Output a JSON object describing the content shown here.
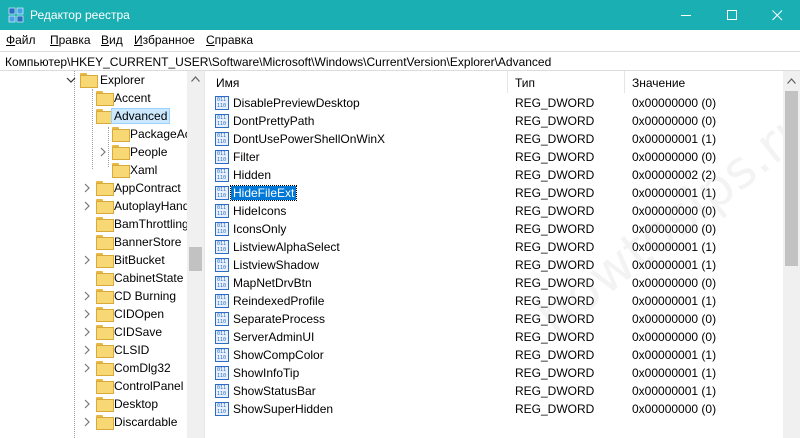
{
  "window": {
    "title": "Редактор реестра",
    "accent": "#1ab0b3"
  },
  "menu": [
    "Файл",
    "Правка",
    "Вид",
    "Избранное",
    "Справка"
  ],
  "address": "Компьютер\\HKEY_CURRENT_USER\\Software\\Microsoft\\Windows\\CurrentVersion\\Explorer\\Advanced",
  "tree": [
    {
      "label": "Explorer",
      "expanded": true
    },
    {
      "label": "Accent"
    },
    {
      "label": "Advanced",
      "selected": true
    },
    {
      "label": "PackageAc"
    },
    {
      "label": "People",
      "expandable": true
    },
    {
      "label": "Xaml"
    },
    {
      "label": "AppContract",
      "expandable": true
    },
    {
      "label": "AutoplayHand",
      "expandable": true
    },
    {
      "label": "BamThrottling"
    },
    {
      "label": "BannerStore"
    },
    {
      "label": "BitBucket",
      "expandable": true
    },
    {
      "label": "CabinetState"
    },
    {
      "label": "CD Burning",
      "expandable": true
    },
    {
      "label": "CIDOpen",
      "expandable": true
    },
    {
      "label": "CIDSave",
      "expandable": true
    },
    {
      "label": "CLSID",
      "expandable": true
    },
    {
      "label": "ComDlg32",
      "expandable": true
    },
    {
      "label": "ControlPanel"
    },
    {
      "label": "Desktop",
      "expandable": true
    },
    {
      "label": "Discardable",
      "expandable": true
    }
  ],
  "columns": {
    "name": "Имя",
    "type": "Тип",
    "value": "Значение"
  },
  "values": [
    {
      "name": "DisablePreviewDesktop",
      "type": "REG_DWORD",
      "value": "0x00000000 (0)"
    },
    {
      "name": "DontPrettyPath",
      "type": "REG_DWORD",
      "value": "0x00000000 (0)"
    },
    {
      "name": "DontUsePowerShellOnWinX",
      "type": "REG_DWORD",
      "value": "0x00000001 (1)"
    },
    {
      "name": "Filter",
      "type": "REG_DWORD",
      "value": "0x00000000 (0)"
    },
    {
      "name": "Hidden",
      "type": "REG_DWORD",
      "value": "0x00000002 (2)"
    },
    {
      "name": "HideFileExt",
      "type": "REG_DWORD",
      "value": "0x00000001 (1)",
      "selected": true
    },
    {
      "name": "HideIcons",
      "type": "REG_DWORD",
      "value": "0x00000000 (0)"
    },
    {
      "name": "IconsOnly",
      "type": "REG_DWORD",
      "value": "0x00000000 (0)"
    },
    {
      "name": "ListviewAlphaSelect",
      "type": "REG_DWORD",
      "value": "0x00000001 (1)"
    },
    {
      "name": "ListviewShadow",
      "type": "REG_DWORD",
      "value": "0x00000001 (1)"
    },
    {
      "name": "MapNetDrvBtn",
      "type": "REG_DWORD",
      "value": "0x00000000 (0)"
    },
    {
      "name": "ReindexedProfile",
      "type": "REG_DWORD",
      "value": "0x00000001 (1)"
    },
    {
      "name": "SeparateProcess",
      "type": "REG_DWORD",
      "value": "0x00000000 (0)"
    },
    {
      "name": "ServerAdminUI",
      "type": "REG_DWORD",
      "value": "0x00000000 (0)"
    },
    {
      "name": "ShowCompColor",
      "type": "REG_DWORD",
      "value": "0x00000001 (1)"
    },
    {
      "name": "ShowInfoTip",
      "type": "REG_DWORD",
      "value": "0x00000001 (1)"
    },
    {
      "name": "ShowStatusBar",
      "type": "REG_DWORD",
      "value": "0x00000001 (1)"
    },
    {
      "name": "ShowSuperHidden",
      "type": "REG_DWORD",
      "value": "0x00000000 (0)"
    }
  ],
  "watermark": "howtosips.ru"
}
